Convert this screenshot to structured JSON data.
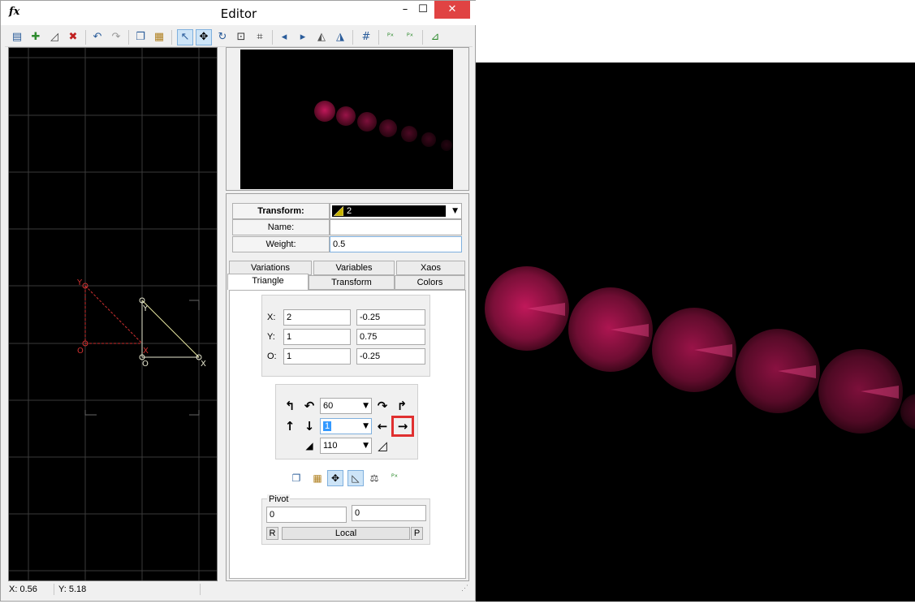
{
  "window": {
    "app_icon": "fx",
    "title": "Editor",
    "min": "–",
    "max": "☐",
    "close": "✕"
  },
  "toolbar": {
    "icons": [
      "new-icon",
      "add-icon",
      "duplicate-icon",
      "delete-icon",
      "undo-icon",
      "redo-icon",
      "copy-icon",
      "paste-icon",
      "select-icon",
      "move-icon",
      "rotate-icon",
      "scale-icon",
      "fit-icon",
      "flip-h-left-icon",
      "flip-h-right-icon",
      "flip-v-icon",
      "flip-h-icon",
      "grid-icon",
      "post-transform-icon",
      "post-transform-2-icon",
      "post-transform-3-icon"
    ],
    "glyphs": [
      "▤",
      "✚",
      "◿",
      "✖",
      "↶",
      "↷",
      "❐",
      "▦",
      "↖",
      "✥",
      "↻",
      "⊡",
      "⌗",
      "◂",
      "▸",
      "◭",
      "◮",
      "#",
      "ᴾˣ",
      "ᴾˣ",
      "⊿"
    ]
  },
  "canvas": {
    "labels": {
      "y_red": "Y",
      "o_red": "O",
      "x_red": "X",
      "y_white": "Y",
      "o_white": "O",
      "x_white": "X"
    }
  },
  "properties": {
    "transform_label": "Transform:",
    "transform_value": "2",
    "name_label": "Name:",
    "name_value": "",
    "weight_label": "Weight:",
    "weight_value": "0.5"
  },
  "tabs": {
    "row1": [
      "Variations",
      "Variables",
      "Xaos"
    ],
    "row2": [
      "Triangle",
      "Transform",
      "Colors"
    ],
    "active": "Triangle"
  },
  "triangle": {
    "x_label": "X:",
    "x1": "2",
    "x2": "-0.25",
    "y_label": "Y:",
    "y1": "1",
    "y2": "0.75",
    "o_label": "O:",
    "o1": "1",
    "o2": "-0.25",
    "rotate_value": "60",
    "move_value": "1",
    "scale_value": "110"
  },
  "pivot": {
    "title": "Pivot",
    "x": "0",
    "y": "0",
    "r_label": "R",
    "local_label": "Local",
    "p_label": "P"
  },
  "status": {
    "x": "X: 0.56",
    "y": "Y: 5.18"
  },
  "colors": {
    "fractal": "#c0185a",
    "highlight": "#e03030"
  }
}
